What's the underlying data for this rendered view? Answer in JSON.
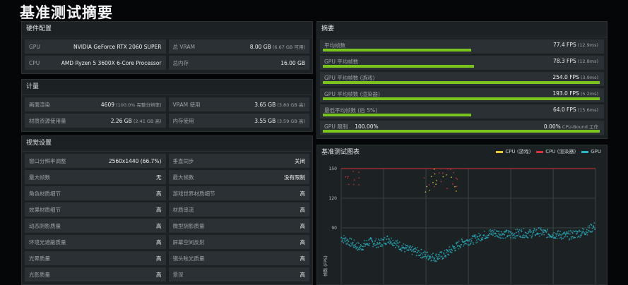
{
  "page_title": "基准测试摘要",
  "hardware": {
    "title": "硬件配置",
    "rows": [
      {
        "left_label": "GPU",
        "left_value": "NVIDIA GeForce RTX 2060 SUPER",
        "left_sub": "",
        "right_label": "总 VRAM",
        "right_value": "8.00 GB",
        "right_sub": "(6.67 GB 可用)"
      },
      {
        "left_label": "CPU",
        "left_value": "AMD Ryzen 5 3600X 6-Core Processor",
        "left_sub": "",
        "right_label": "总内存",
        "right_value": "16.00 GB",
        "right_sub": ""
      }
    ]
  },
  "metrics": {
    "title": "计量",
    "rows": [
      {
        "left_label": "画面渲染",
        "left_value": "4609",
        "left_sub": "(100.0% 完整分辨率)",
        "right_label": "VRAM 使用",
        "right_value": "3.65 GB",
        "right_sub": "(3.80 GB 高)"
      },
      {
        "left_label": "材质资源使用量",
        "left_value": "2.26 GB",
        "left_sub": "(2.41 GB 高)",
        "right_label": "内存使用",
        "right_value": "3.55 GB",
        "right_sub": "(3.59 GB 高)"
      }
    ]
  },
  "visual": {
    "title": "视觉设置",
    "rows": [
      {
        "left_label": "窗口分辨率调整",
        "left_value": "2560x1440 (66.7%)",
        "right_label": "垂直同步",
        "right_value": "关闭"
      },
      {
        "left_label": "最大帧数",
        "left_value": "无",
        "right_label": "最大帧数",
        "right_value": "没有限制"
      },
      {
        "left_label": "角色材质细节",
        "left_value": "高",
        "right_label": "游戏世界材质细节",
        "right_value": "高"
      },
      {
        "left_label": "效果材质细节",
        "left_value": "高",
        "right_label": "材质串流",
        "right_value": "高"
      },
      {
        "left_label": "动态阴影质量",
        "left_value": "高",
        "right_label": "微型阴影质量",
        "right_value": "高"
      },
      {
        "left_label": "环境光遮蔽质量",
        "left_value": "高",
        "right_label": "屏幕空间反射",
        "right_value": "高"
      },
      {
        "left_label": "光晕质量",
        "left_value": "高",
        "right_label": "镜头眩光质量",
        "right_value": "高"
      },
      {
        "left_label": "光影质量",
        "left_value": "高",
        "right_label": "景深",
        "right_value": "高"
      }
    ]
  },
  "summary": {
    "title": "摘要",
    "rows": [
      {
        "label": "平均帧数",
        "value": "77.4 FPS",
        "sub": "(12.9ms)",
        "fill": 0.53
      },
      {
        "label": "GPU 平均帧数",
        "value": "78.3 FPS",
        "sub": "(12.8ms)",
        "fill": 0.54
      },
      {
        "label": "GPU 平均帧数 (游戏)",
        "value": "254.0 FPS",
        "sub": "(3.9ms)",
        "fill": 0.99
      },
      {
        "label": "GPU 平均帧数 (渲染器)",
        "value": "193.0 FPS",
        "sub": "(5.2ms)",
        "fill": 0.99
      },
      {
        "label": "最低平均帧数 (后 5%)",
        "value": "64.0 FPS",
        "sub": "(15.6ms)",
        "fill": 0.53
      },
      {
        "label": "GPU 限制",
        "label_value": "100.00%",
        "value": "0.00%",
        "sub": "CPU-Bound 工作",
        "fill": 0.99
      }
    ]
  },
  "chart_panel": {
    "title": "基准测试图表",
    "legend": [
      {
        "name": "CPU (游戏)",
        "color": "#e8c838"
      },
      {
        "name": "CPU (渲染器)",
        "color": "#d8323a"
      },
      {
        "name": "GPU",
        "color": "#2ab5c6"
      }
    ],
    "y_axis_label": "帧数 (FPS)"
  },
  "chart_data": {
    "type": "scatter",
    "ylim": [
      30,
      150
    ],
    "y_ticks": [
      "150",
      "120",
      "90"
    ],
    "x_gridlines": 7,
    "series": [
      {
        "name": "CPU (游戏)",
        "color": "#e8c838",
        "values": [
          150,
          150,
          150,
          150,
          150,
          150,
          150,
          150,
          150,
          150,
          150,
          150
        ]
      },
      {
        "name": "CPU (渲染器)",
        "color": "#d8323a",
        "values": [
          150,
          150,
          150,
          150,
          150,
          150,
          150,
          150,
          150,
          150,
          150,
          150
        ]
      },
      {
        "name": "GPU",
        "color": "#2ab5c6",
        "values": [
          80,
          75,
          70,
          76,
          74,
          79,
          73,
          68,
          66,
          62,
          60,
          63,
          70,
          76,
          78,
          82,
          85,
          84,
          83,
          85,
          84,
          86,
          84,
          83,
          82,
          84,
          87,
          92
        ]
      }
    ]
  }
}
